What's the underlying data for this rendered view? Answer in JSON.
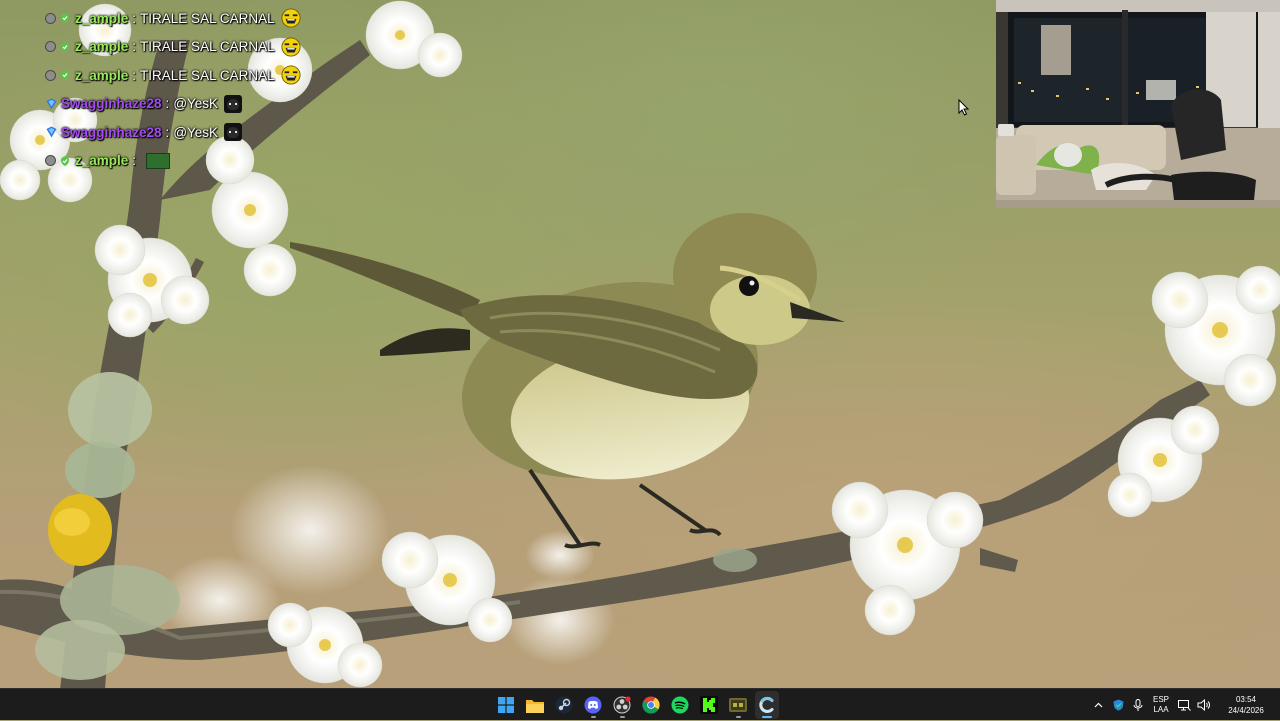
{
  "chat": {
    "messages": [
      {
        "user": "z_ample",
        "sep": ":",
        "text": "TIRALE SAL CARNAL",
        "user_color": "#9be85e",
        "badges": [
          "moderator-icon",
          "verified-icon"
        ],
        "emote": "laughing-emote"
      },
      {
        "user": "z_ample",
        "sep": ":",
        "text": "TIRALE SAL CARNAL",
        "user_color": "#9be85e",
        "badges": [
          "moderator-icon",
          "verified-icon"
        ],
        "emote": "laughing-emote"
      },
      {
        "user": "z_ample",
        "sep": ":",
        "text": "TIRALE SAL CARNAL",
        "user_color": "#9be85e",
        "badges": [
          "moderator-icon",
          "verified-icon"
        ],
        "emote": "laughing-emote"
      },
      {
        "user": "Swagginhaze28",
        "sep": ":",
        "text": "@YesK",
        "user_color": "#a44cf0",
        "badges": [
          "sub-badge-icon"
        ],
        "emote": "cat-emote"
      },
      {
        "user": "Swagginhaze28",
        "sep": ":",
        "text": "@YesK",
        "user_color": "#a44cf0",
        "badges": [
          "sub-badge-icon"
        ],
        "emote": "cat-emote"
      },
      {
        "user": "z_ample",
        "sep": ":",
        "text": "",
        "user_color": "#9be85e",
        "badges": [
          "moderator-icon",
          "verified-icon"
        ],
        "emote": "green-emote"
      }
    ]
  },
  "taskbar": {
    "apps": [
      {
        "name": "start",
        "icon": "windows-start-icon"
      },
      {
        "name": "file-explorer",
        "icon": "folder-icon"
      },
      {
        "name": "steam",
        "icon": "steam-icon"
      },
      {
        "name": "discord",
        "icon": "discord-icon"
      },
      {
        "name": "obs",
        "icon": "obs-icon"
      },
      {
        "name": "chrome",
        "icon": "chrome-icon"
      },
      {
        "name": "spotify",
        "icon": "spotify-icon"
      },
      {
        "name": "kick",
        "icon": "kick-icon"
      },
      {
        "name": "game",
        "icon": "game-icon"
      },
      {
        "name": "app",
        "icon": "c-app-icon"
      }
    ],
    "tray": {
      "language_top": "ESP",
      "language_bottom": "LAA",
      "time": "03:54",
      "date": "24/4/2026"
    }
  },
  "colors": {
    "taskbar_bg": "#1c1c1c",
    "accent_blue": "#1e90ff",
    "chat_green": "#9be85e",
    "chat_purple": "#a44cf0"
  }
}
